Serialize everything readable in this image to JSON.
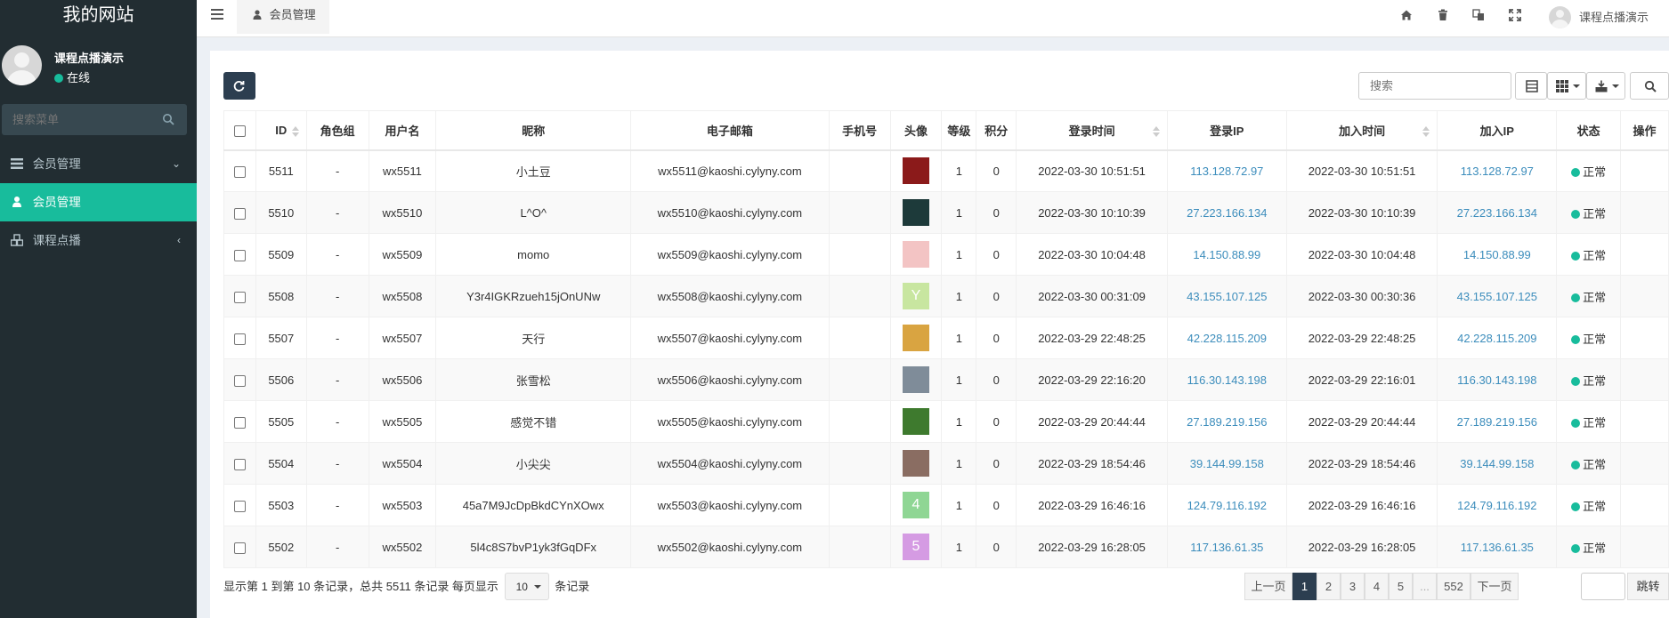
{
  "sidebar": {
    "logo": "我的网站",
    "user": {
      "name": "课程点播演示",
      "status": "在线"
    },
    "search_placeholder": "搜索菜单",
    "menu": [
      {
        "label": "会员管理",
        "arrow": "⌄"
      },
      {
        "label": "会员管理",
        "arrow": ""
      },
      {
        "label": "课程点播",
        "arrow": "‹"
      }
    ]
  },
  "topbar": {
    "tab_label": "会员管理",
    "user_name": "课程点播演示"
  },
  "toolbar": {
    "search_placeholder": "搜索"
  },
  "table": {
    "headers": [
      "ID",
      "角色组",
      "用户名",
      "昵称",
      "电子邮箱",
      "手机号",
      "头像",
      "等级",
      "积分",
      "登录时间",
      "登录IP",
      "加入时间",
      "加入IP",
      "状态",
      "操作"
    ],
    "rows": [
      {
        "id": "5511",
        "group": "-",
        "username": "wx5511",
        "nickname": "小土豆",
        "email": "wx5511@kaoshi.cylyny.com",
        "mobile": "",
        "avatar": {
          "color": "#8b1a1a",
          "text": ""
        },
        "level": "1",
        "score": "0",
        "login_time": "2022-03-30 10:51:51",
        "login_ip": "113.128.72.97",
        "join_time": "2022-03-30 10:51:51",
        "join_ip": "113.128.72.97",
        "status": "正常"
      },
      {
        "id": "5510",
        "group": "-",
        "username": "wx5510",
        "nickname": "L^O^",
        "email": "wx5510@kaoshi.cylyny.com",
        "mobile": "",
        "avatar": {
          "color": "#1d3a3a",
          "text": ""
        },
        "level": "1",
        "score": "0",
        "login_time": "2022-03-30 10:10:39",
        "login_ip": "27.223.166.134",
        "join_time": "2022-03-30 10:10:39",
        "join_ip": "27.223.166.134",
        "status": "正常"
      },
      {
        "id": "5509",
        "group": "-",
        "username": "wx5509",
        "nickname": "momo",
        "email": "wx5509@kaoshi.cylyny.com",
        "mobile": "",
        "avatar": {
          "color": "#f3c4c4",
          "text": ""
        },
        "level": "1",
        "score": "0",
        "login_time": "2022-03-30 10:04:48",
        "login_ip": "14.150.88.99",
        "join_time": "2022-03-30 10:04:48",
        "join_ip": "14.150.88.99",
        "status": "正常"
      },
      {
        "id": "5508",
        "group": "-",
        "username": "wx5508",
        "nickname": "Y3r4IGKRzueh15jOnUNw",
        "email": "wx5508@kaoshi.cylyny.com",
        "mobile": "",
        "avatar": {
          "color": "#c8e6a0",
          "text": "Y"
        },
        "level": "1",
        "score": "0",
        "login_time": "2022-03-30 00:31:09",
        "login_ip": "43.155.107.125",
        "join_time": "2022-03-30 00:30:36",
        "join_ip": "43.155.107.125",
        "status": "正常"
      },
      {
        "id": "5507",
        "group": "-",
        "username": "wx5507",
        "nickname": "天行",
        "email": "wx5507@kaoshi.cylyny.com",
        "mobile": "",
        "avatar": {
          "color": "#d9a441",
          "text": ""
        },
        "level": "1",
        "score": "0",
        "login_time": "2022-03-29 22:48:25",
        "login_ip": "42.228.115.209",
        "join_time": "2022-03-29 22:48:25",
        "join_ip": "42.228.115.209",
        "status": "正常"
      },
      {
        "id": "5506",
        "group": "-",
        "username": "wx5506",
        "nickname": "张雪松",
        "email": "wx5506@kaoshi.cylyny.com",
        "mobile": "",
        "avatar": {
          "color": "#7f8c99",
          "text": ""
        },
        "level": "1",
        "score": "0",
        "login_time": "2022-03-29 22:16:20",
        "login_ip": "116.30.143.198",
        "join_time": "2022-03-29 22:16:01",
        "join_ip": "116.30.143.198",
        "status": "正常"
      },
      {
        "id": "5505",
        "group": "-",
        "username": "wx5505",
        "nickname": "感觉不错",
        "email": "wx5505@kaoshi.cylyny.com",
        "mobile": "",
        "avatar": {
          "color": "#3e7a2e",
          "text": ""
        },
        "level": "1",
        "score": "0",
        "login_time": "2022-03-29 20:44:44",
        "login_ip": "27.189.219.156",
        "join_time": "2022-03-29 20:44:44",
        "join_ip": "27.189.219.156",
        "status": "正常"
      },
      {
        "id": "5504",
        "group": "-",
        "username": "wx5504",
        "nickname": "小尖尖",
        "email": "wx5504@kaoshi.cylyny.com",
        "mobile": "",
        "avatar": {
          "color": "#8a6d62",
          "text": ""
        },
        "level": "1",
        "score": "0",
        "login_time": "2022-03-29 18:54:46",
        "login_ip": "39.144.99.158",
        "join_time": "2022-03-29 18:54:46",
        "join_ip": "39.144.99.158",
        "status": "正常"
      },
      {
        "id": "5503",
        "group": "-",
        "username": "wx5503",
        "nickname": "45a7M9JcDpBkdCYnXOwx",
        "email": "wx5503@kaoshi.cylyny.com",
        "mobile": "",
        "avatar": {
          "color": "#8fd694",
          "text": "4"
        },
        "level": "1",
        "score": "0",
        "login_time": "2022-03-29 16:46:16",
        "login_ip": "124.79.116.192",
        "join_time": "2022-03-29 16:46:16",
        "join_ip": "124.79.116.192",
        "status": "正常"
      },
      {
        "id": "5502",
        "group": "-",
        "username": "wx5502",
        "nickname": "5l4c8S7bvP1yk3fGqDFx",
        "email": "wx5502@kaoshi.cylyny.com",
        "mobile": "",
        "avatar": {
          "color": "#d59be3",
          "text": "5"
        },
        "level": "1",
        "score": "0",
        "login_time": "2022-03-29 16:28:05",
        "login_ip": "117.136.61.35",
        "join_time": "2022-03-29 16:28:05",
        "join_ip": "117.136.61.35",
        "status": "正常"
      }
    ]
  },
  "pagination": {
    "info_prefix": "显示第 1 到第 10 条记录，总共 5511 条记录 每页显示",
    "page_size": "10",
    "info_suffix": "条记录",
    "prev": "上一页",
    "pages": [
      "1",
      "2",
      "3",
      "4",
      "5",
      "...",
      "552"
    ],
    "next": "下一页",
    "jump": "跳转"
  },
  "colors": {
    "sidebar_bg": "#222d32",
    "accent": "#18bc9c",
    "primary": "#2c3e50",
    "link": "#3c8dbc"
  }
}
